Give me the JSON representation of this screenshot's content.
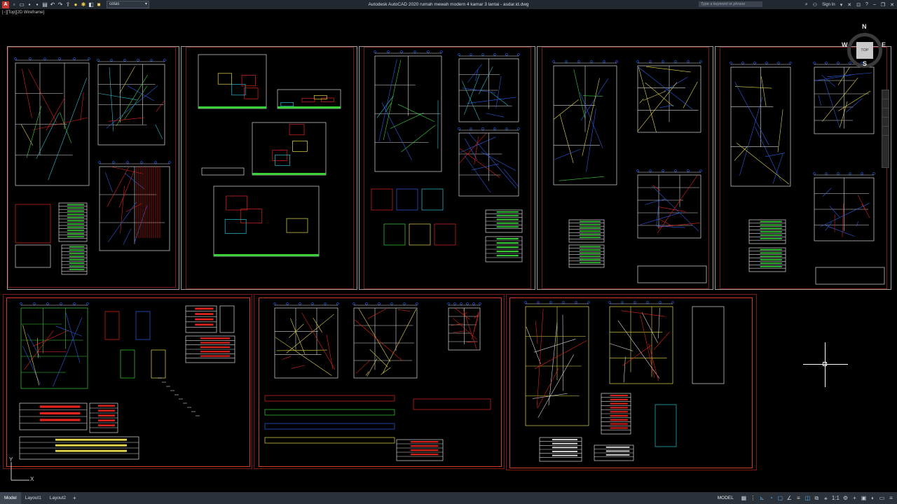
{
  "app": {
    "window_title": "Autodesk AutoCAD 2020   rumah mewah modern 4 kamar 3 lantai - asdar.id.dwg",
    "current_layer": "cotas",
    "search_placeholder": "Type a keyword or phrase",
    "sign_in_label": "Sign In",
    "viewport_label": "[−][Top][2D Wireframe]"
  },
  "quick_access": {
    "icons": [
      "new-icon",
      "open-icon",
      "save-icon",
      "save-as-icon",
      "print-icon",
      "undo-icon",
      "redo-icon",
      "share-icon",
      "lightbulb-icon",
      "sun-icon",
      "layer-state-icon",
      "color-icon"
    ]
  },
  "viewcube": {
    "face": "TOP",
    "north": "N",
    "south": "S",
    "east": "E",
    "west": "W"
  },
  "ucs": {
    "x_label": "X",
    "y_label": "Y"
  },
  "status_bar": {
    "tabs": [
      {
        "label": "Model",
        "active": true
      },
      {
        "label": "Layout1",
        "active": false
      },
      {
        "label": "Layout2",
        "active": false
      }
    ],
    "add_tab": "+",
    "space_label": "MODEL",
    "scale": "1:1",
    "icons": [
      "grid-icon",
      "snap-icon",
      "ortho-icon",
      "polar-icon",
      "osnap-icon",
      "otrack-icon",
      "lineweight-icon",
      "transparency-icon",
      "selection-cycling-icon",
      "3dosnap-icon",
      "annotation-scale-icon",
      "workspace-icon",
      "annotation-monitor-icon",
      "units-icon",
      "quick-properties-icon",
      "lock-ui-icon",
      "isolate-icon",
      "hardware-accel-icon",
      "clean-screen-icon",
      "customize-icon"
    ]
  },
  "colors": {
    "canvas": "#000000",
    "sheet_border": "#d23a2a",
    "sheet_frame": "#a0a0a0",
    "titlebar": "#212830",
    "statusbar": "#2a3138",
    "cad_yellow": "#e6d84a",
    "cad_green": "#3bd13b",
    "cad_red": "#e0241c",
    "cad_blue": "#2a5fe6",
    "cad_cyan": "#27c3d8",
    "cad_white": "#d8d8d8"
  }
}
